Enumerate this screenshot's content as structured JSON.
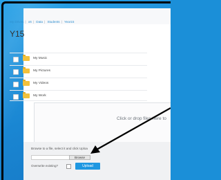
{
  "breadcrumb": [
    "My Drives",
    "x6",
    "Data",
    "Students",
    "Year15"
  ],
  "page_title": "Y15",
  "folders": [
    {
      "name": "My Music"
    },
    {
      "name": "My Pictures"
    },
    {
      "name": "My Videos"
    },
    {
      "name": "My Work"
    }
  ],
  "dropzone": {
    "text": "Click or drop files here to"
  },
  "upload": {
    "hint": "Browse to a file, select it and click Uploa",
    "browse_label": "Browse",
    "overwrite_label": "Overwrite existing?",
    "upload_label": "Upload"
  },
  "colors": {
    "accent": "#1e97e1",
    "folder": "#f2c13c",
    "desktop": "#1b8fd8"
  }
}
